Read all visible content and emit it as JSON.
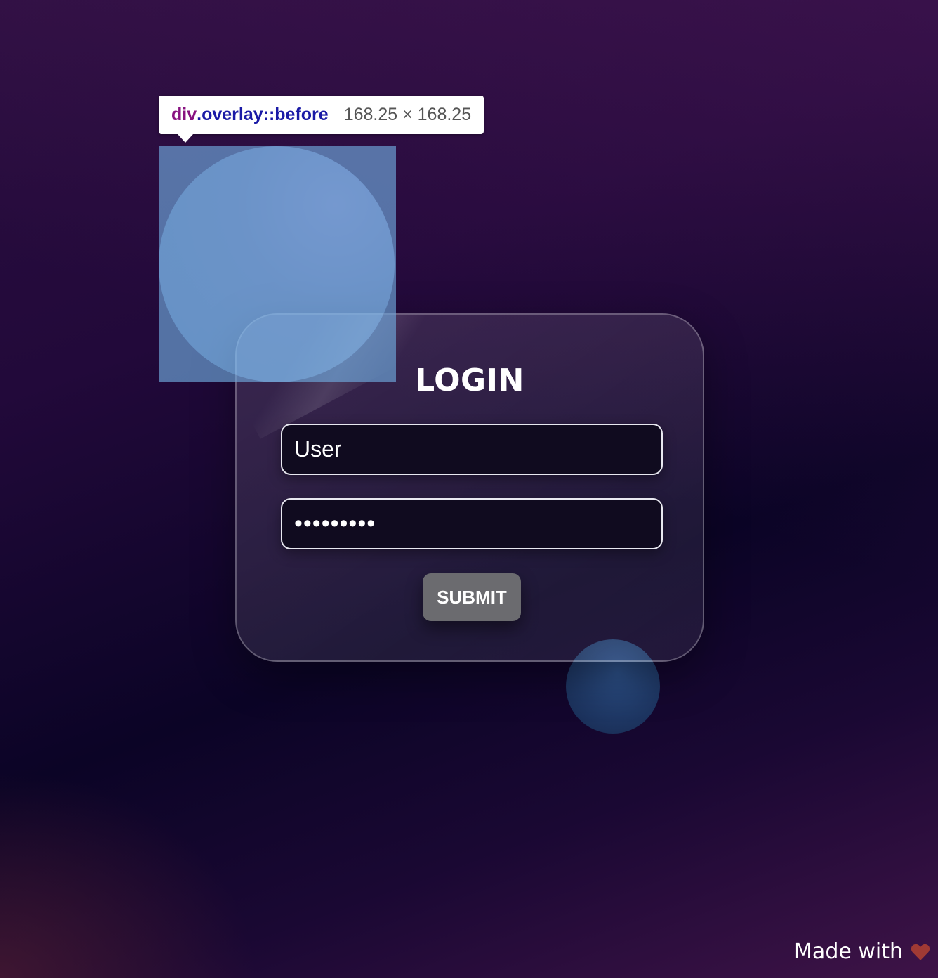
{
  "devtools_tooltip": {
    "tag": "div",
    "class_selector": ".overlay::before",
    "dimensions": "168.25 × 168.25"
  },
  "login_card": {
    "title": "LOGIN",
    "username_value": "User",
    "password_value": "•••••••••",
    "submit_label": "SUBMIT"
  },
  "footer": {
    "made_with_text": "Made with",
    "heart_icon": "heart-icon",
    "heart_color": "#a03a34"
  },
  "colors": {
    "highlight": "#6fa8dc",
    "tooltip_tag": "#881280",
    "tooltip_class": "#1a1aa6",
    "submit_bg": "#6b6b6f"
  }
}
